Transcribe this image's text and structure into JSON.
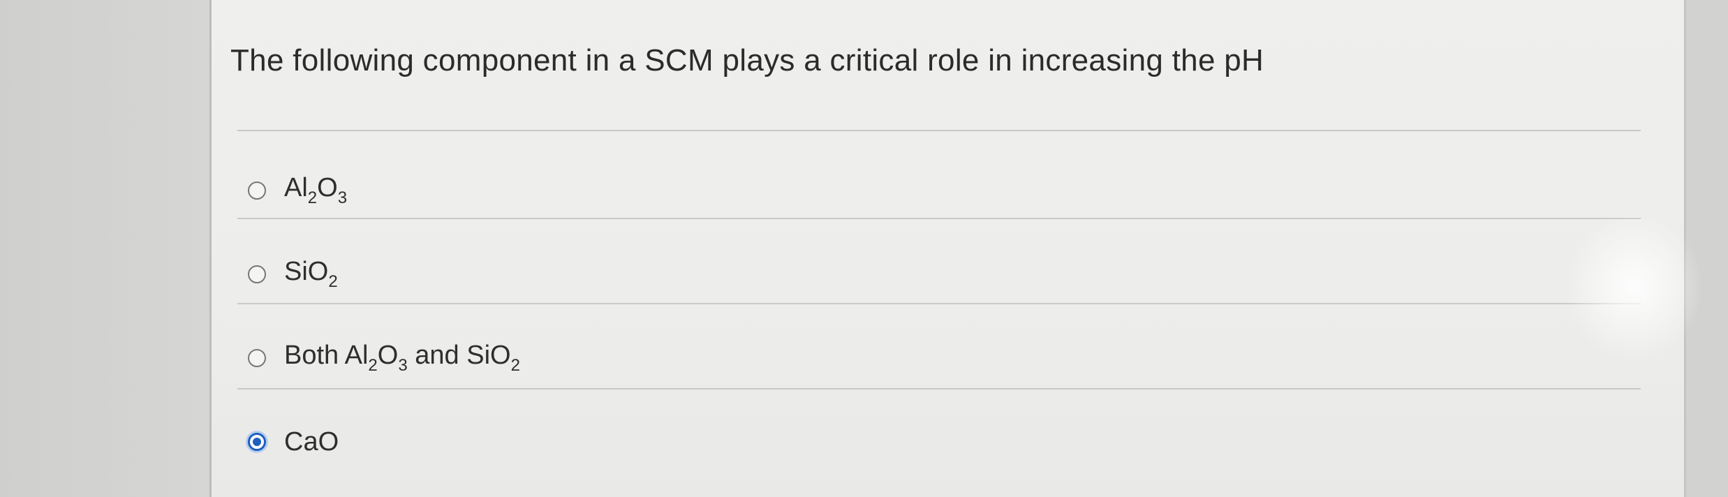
{
  "question": {
    "text": "The following component in a SCM plays a critical role in increasing the pH"
  },
  "options": [
    {
      "main": "Al",
      "sub1": "2",
      "mid": "O",
      "sub2": "3",
      "selected": false
    },
    {
      "main": "SiO",
      "sub1": "2",
      "selected": false
    },
    {
      "prefix": "Both Al",
      "sub1": "2",
      "mid": "O",
      "sub2": "3",
      "joiner": " and SiO",
      "sub3": "2",
      "selected": false
    },
    {
      "main": "CaO",
      "selected": true
    }
  ],
  "colors": {
    "radio_selected": "#1d5fbf",
    "text": "#2e2e2e"
  }
}
